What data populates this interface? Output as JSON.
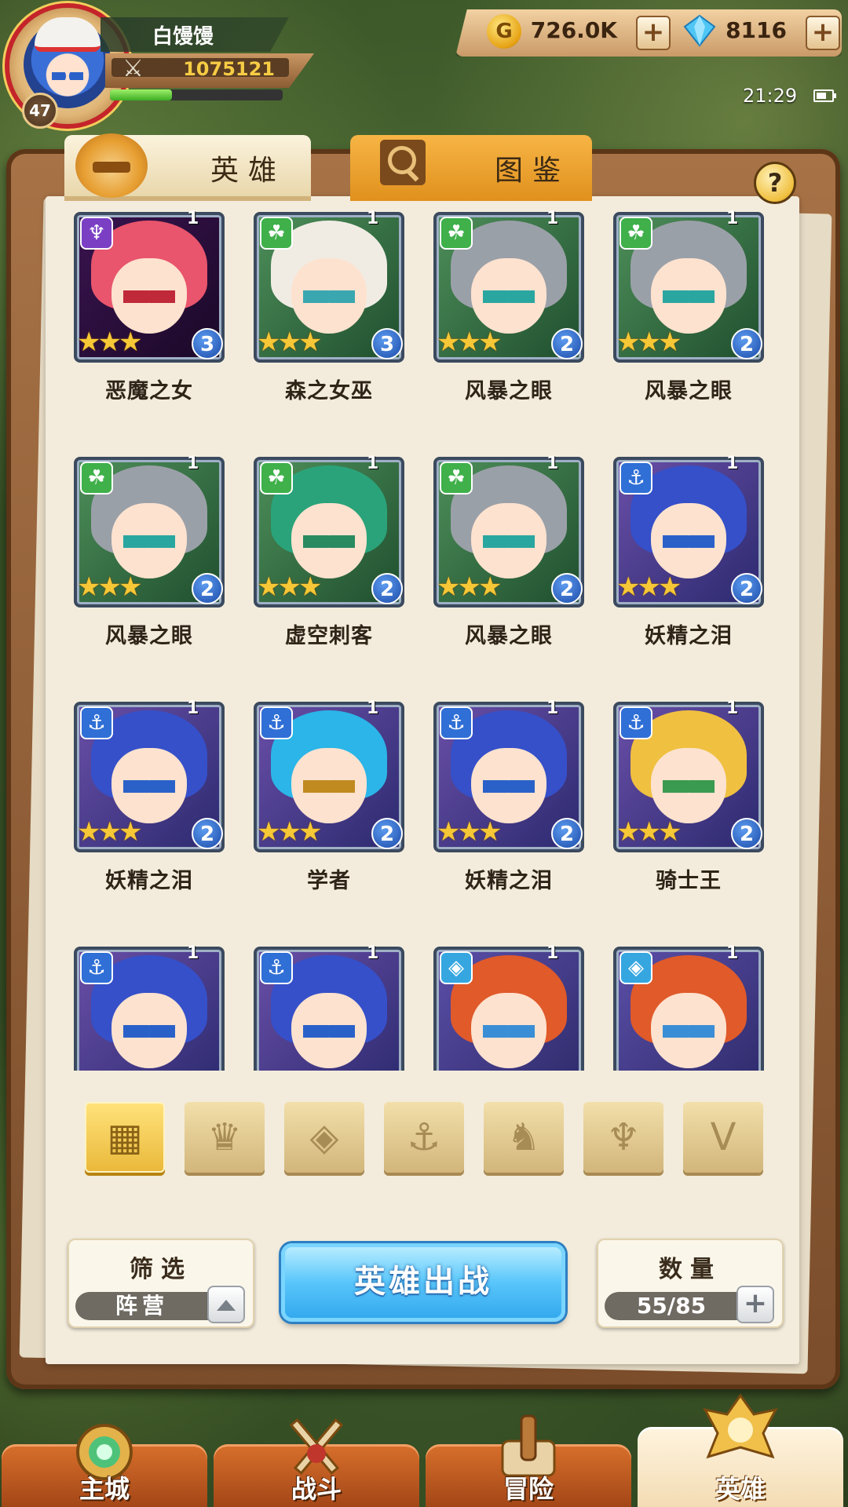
{
  "player": {
    "name": "白馒馒",
    "level": "47",
    "power": "1075121",
    "exp_fraction": 0.36
  },
  "resources": {
    "gold": "726.0K",
    "gems": "8116"
  },
  "status": {
    "time": "21:29"
  },
  "tabs": {
    "hero": "英雄",
    "codex": "图鉴"
  },
  "help_label": "?",
  "heroes": [
    {
      "name": "恶魔之女",
      "faction": "demon",
      "level": "1",
      "stars": 3,
      "rank": "3"
    },
    {
      "name": "森之女巫",
      "faction": "beast",
      "level": "1",
      "stars": 3,
      "rank": "3"
    },
    {
      "name": "风暴之眼",
      "faction": "beast",
      "level": "1",
      "stars": 3,
      "rank": "2"
    },
    {
      "name": "风暴之眼",
      "faction": "beast",
      "level": "1",
      "stars": 3,
      "rank": "2"
    },
    {
      "name": "风暴之眼",
      "faction": "beast",
      "level": "1",
      "stars": 3,
      "rank": "2"
    },
    {
      "name": "虚空刺客",
      "faction": "beast",
      "level": "1",
      "stars": 3,
      "rank": "2"
    },
    {
      "name": "风暴之眼",
      "faction": "beast",
      "level": "1",
      "stars": 3,
      "rank": "2"
    },
    {
      "name": "妖精之泪",
      "faction": "anchor",
      "level": "1",
      "stars": 3,
      "rank": "2"
    },
    {
      "name": "妖精之泪",
      "faction": "anchor",
      "level": "1",
      "stars": 3,
      "rank": "2"
    },
    {
      "name": "学者",
      "faction": "anchor",
      "level": "1",
      "stars": 3,
      "rank": "2"
    },
    {
      "name": "妖精之泪",
      "faction": "anchor",
      "level": "1",
      "stars": 3,
      "rank": "2"
    },
    {
      "name": "骑士王",
      "faction": "anchor",
      "level": "1",
      "stars": 3,
      "rank": "2"
    },
    {
      "name": "",
      "faction": "anchor",
      "level": "1",
      "stars": 0,
      "rank": ""
    },
    {
      "name": "",
      "faction": "anchor",
      "level": "1",
      "stars": 0,
      "rank": ""
    },
    {
      "name": "",
      "faction": "rune",
      "level": "1",
      "stars": 0,
      "rank": ""
    },
    {
      "name": "",
      "faction": "rune",
      "level": "1",
      "stars": 0,
      "rank": ""
    }
  ],
  "faction_filters": [
    {
      "id": "all",
      "icon": "grid-icon",
      "active": true
    },
    {
      "id": "nature",
      "icon": "leaf-crown-icon",
      "active": false
    },
    {
      "id": "rune",
      "icon": "rune-diamond-icon",
      "active": false
    },
    {
      "id": "anchor",
      "icon": "anchor-icon",
      "active": false
    },
    {
      "id": "beast",
      "icon": "beast-head-icon",
      "active": false
    },
    {
      "id": "demon",
      "icon": "demon-horns-icon",
      "active": false
    },
    {
      "id": "wing",
      "icon": "wing-v-icon",
      "active": false
    }
  ],
  "filter_box": {
    "title": "筛选",
    "value": "阵营"
  },
  "deploy_button": "英雄出战",
  "count_box": {
    "title": "数量",
    "value": "55/85"
  },
  "nav": [
    {
      "label": "主城",
      "active": false
    },
    {
      "label": "战斗",
      "active": false
    },
    {
      "label": "冒险",
      "active": false
    },
    {
      "label": "英雄",
      "active": true
    }
  ],
  "colors": {
    "faction_demon": "#7b3fc4",
    "faction_beast": "#3fb04a",
    "faction_anchor": "#2f6fd6",
    "faction_rune": "#35a6e0",
    "accent_gold": "#f6cc45",
    "deploy_blue": "#33a9ee"
  }
}
